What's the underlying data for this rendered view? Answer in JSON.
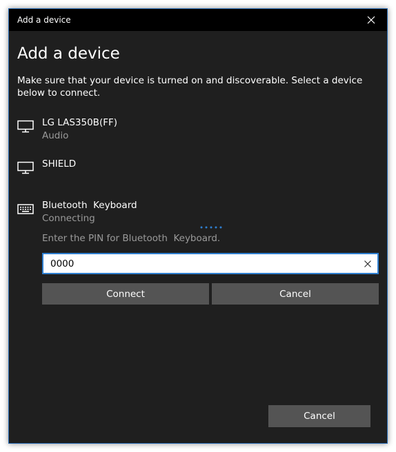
{
  "window": {
    "title": "Add a device"
  },
  "heading": "Add a device",
  "instruction": "Make sure that your device is turned on and discoverable. Select a device below to connect.",
  "devices": [
    {
      "name": "LG LAS350B(FF)",
      "status": "Audio",
      "icon": "monitor-icon"
    },
    {
      "name": "SHIELD",
      "status": "",
      "icon": "monitor-icon"
    },
    {
      "name": "Bluetooth  Keyboard",
      "status": "Connecting",
      "icon": "keyboard-icon"
    }
  ],
  "pairing": {
    "prompt": "Enter the PIN for Bluetooth  Keyboard.",
    "pin_value": "0000",
    "connect_label": "Connect",
    "cancel_label": "Cancel"
  },
  "footer": {
    "cancel_label": "Cancel"
  },
  "colors": {
    "background": "#1f1f1f",
    "titlebar": "#000000",
    "accent": "#2f7fd0",
    "button": "#545454",
    "secondary_text": "#9a9a9a"
  }
}
